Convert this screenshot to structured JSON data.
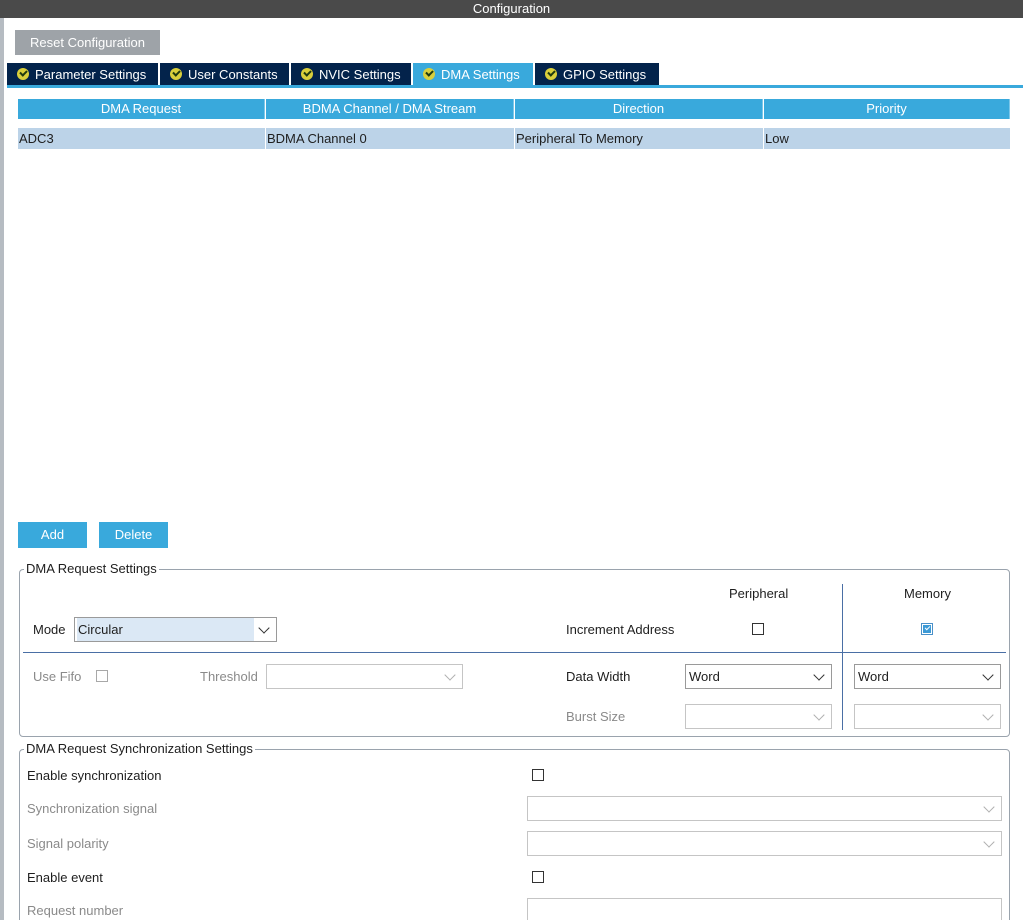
{
  "title": "Configuration",
  "reset_button": "Reset Configuration",
  "tabs": [
    {
      "label": "Parameter Settings",
      "active": false
    },
    {
      "label": "User Constants",
      "active": false
    },
    {
      "label": "NVIC Settings",
      "active": false
    },
    {
      "label": "DMA Settings",
      "active": true
    },
    {
      "label": "GPIO Settings",
      "active": false
    }
  ],
  "table": {
    "columns": [
      "DMA Request",
      "BDMA Channel / DMA Stream",
      "Direction",
      "Priority"
    ],
    "rows": [
      [
        "ADC3",
        "BDMA Channel 0",
        "Peripheral To Memory",
        "Low"
      ]
    ]
  },
  "buttons": {
    "add": "Add",
    "delete": "Delete"
  },
  "dma_request_settings": {
    "title": "DMA Request Settings",
    "peripheral_header": "Peripheral",
    "memory_header": "Memory",
    "mode_label": "Mode",
    "mode_value": "Circular",
    "increment_address_label": "Increment Address",
    "increment_peripheral": false,
    "increment_memory": true,
    "use_fifo_label": "Use Fifo",
    "threshold_label": "Threshold",
    "threshold_value": "",
    "data_width_label": "Data Width",
    "data_width_peripheral": "Word",
    "data_width_memory": "Word",
    "burst_size_label": "Burst Size",
    "burst_peripheral": "",
    "burst_memory": ""
  },
  "sync_settings": {
    "title": "DMA Request Synchronization Settings",
    "enable_sync_label": "Enable synchronization",
    "sync_signal_label": "Synchronization signal",
    "sync_signal_value": "",
    "signal_polarity_label": "Signal polarity",
    "signal_polarity_value": "",
    "enable_event_label": "Enable event",
    "request_number_label": "Request number",
    "request_number_value": ""
  },
  "colors": {
    "accent": "#39a9dc",
    "tab_dark": "#03234b",
    "titlebar": "#4a4a4a",
    "row_selected": "#bcd3e8"
  }
}
